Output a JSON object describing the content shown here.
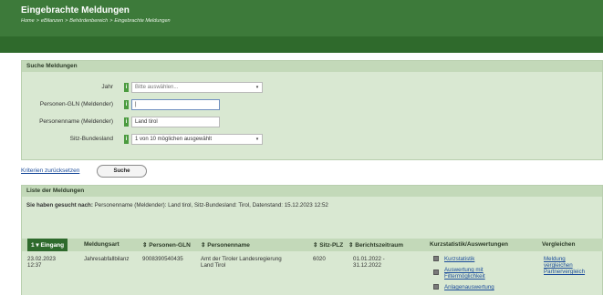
{
  "header": {
    "title": "Eingebrachte Meldungen",
    "breadcrumbs": [
      "Home",
      "eBilanzen",
      "Behördenbereich",
      "Eingebrachte Meldungen"
    ]
  },
  "search": {
    "title": "Suche Meldungen",
    "fields": {
      "jahr": {
        "label": "Jahr",
        "value": "Bitte auswählen..."
      },
      "gln": {
        "label": "Personen-GLN (Meldender)",
        "value": "|"
      },
      "name": {
        "label": "Personenname (Meldender)",
        "value": "Land tirol"
      },
      "bundesland": {
        "label": "Sitz-Bundesland",
        "value": "1 von 10 möglichen ausgewählt"
      }
    },
    "reset_label": "Kriterien zurücksetzen",
    "search_button": "Suche"
  },
  "list": {
    "title": "Liste der Meldungen",
    "summary_prefix": "Sie haben gesucht nach:",
    "summary_text": "Personenname (Meldender): Land tirol, Sitz-Bundesland: Tirol, Datenstand: 15.12.2023 12:52",
    "columns": [
      "1 ▾ Eingang",
      "Meldungsart",
      "⇕ Personen-GLN",
      "⇕ Personenname",
      "⇕ Sitz-PLZ",
      "⇕ Berichtszeitraum",
      "Kurzstatistik/Auswertungen",
      "Vergleichen"
    ],
    "rows": [
      {
        "eingang": "23.02.2023",
        "eingang_time": "12:37",
        "meldungsart": "Jahresabfallbilanz",
        "gln": "9008390540435",
        "name_l1": "Amt der Tiroler Landesregierung",
        "name_l2": "Land Tirol",
        "plz": "6020",
        "zeitraum_l1": "01.01.2022 -",
        "zeitraum_l2": "31.12.2022",
        "auswertungen": [
          "Kurzstatistik",
          "Auswertung mit",
          "Filtermöglichkeit",
          "Anlagenauswertung"
        ],
        "vergleichen": [
          "Meldung",
          "vergleichen",
          "Partnervergleich"
        ]
      }
    ]
  },
  "colors": {
    "header_green": "#3d7a3a",
    "panel_bg": "#d9e8d2",
    "panel_head": "#c3d9b9",
    "info_green": "#4b9b3f",
    "link_blue": "#1a4b9a"
  },
  "icons": [
    "info-icon",
    "dropdown-arrow-icon",
    "document-icon",
    "chart-icon"
  ]
}
